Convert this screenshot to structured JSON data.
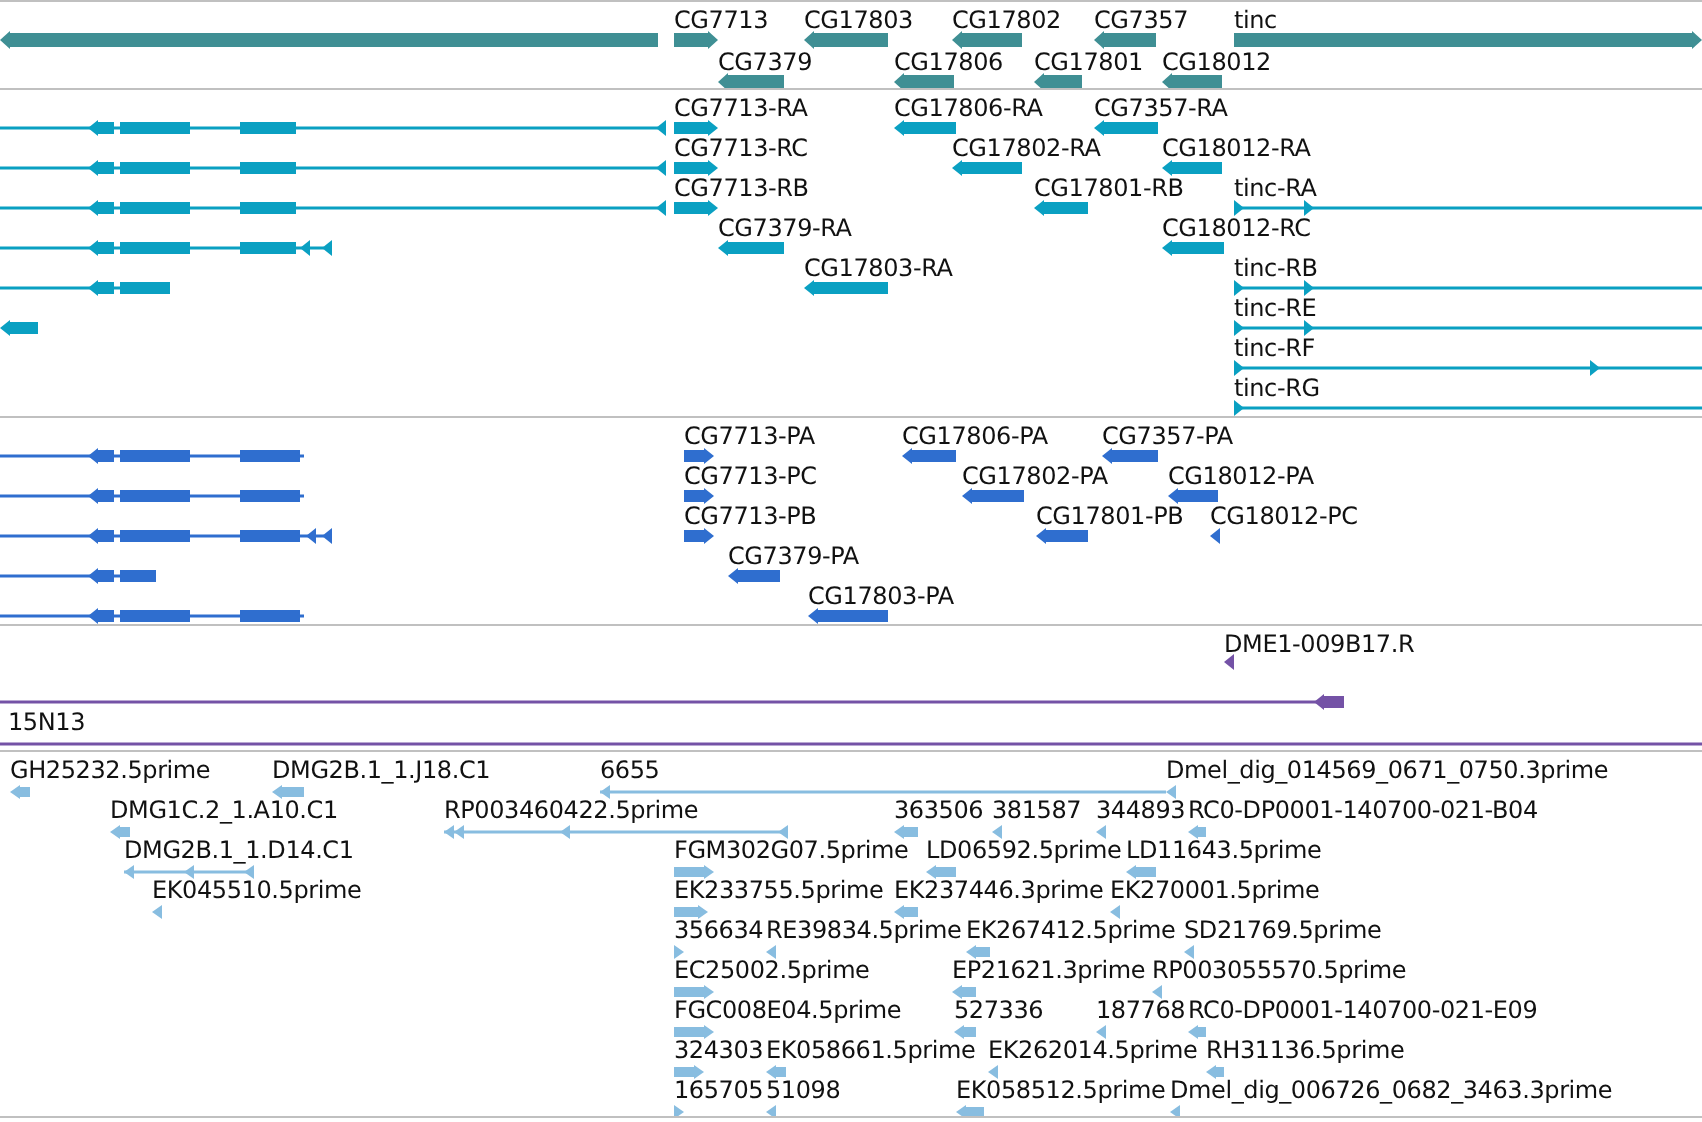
{
  "tracks": [
    {
      "kind": "gene",
      "features": [
        {
          "reverse": true
        },
        {
          "label": "CG7713",
          "reverse": false
        },
        {
          "label": "CG17803",
          "reverse": true
        },
        {
          "label": "CG17802",
          "reverse": true
        },
        {
          "label": "CG7357",
          "reverse": true
        },
        {
          "label": "tinc",
          "reverse": false
        },
        {
          "label": "CG7379",
          "reverse": true
        },
        {
          "label": "CG17806",
          "reverse": true
        },
        {
          "label": "CG17801",
          "reverse": true
        },
        {
          "label": "CG18012",
          "reverse": true
        }
      ]
    },
    {
      "kind": "transcript",
      "features": [
        {
          "reverse": true
        },
        {
          "label": "CG7713-RA",
          "reverse": false
        },
        {
          "label": "CG17806-RA",
          "reverse": true
        },
        {
          "label": "CG7357-RA",
          "reverse": true
        },
        {
          "reverse": true
        },
        {
          "label": "CG7713-RC",
          "reverse": false
        },
        {
          "label": "CG17802-RA",
          "reverse": true
        },
        {
          "label": "CG18012-RA",
          "reverse": true
        },
        {
          "reverse": true
        },
        {
          "label": "CG7713-RB",
          "reverse": false
        },
        {
          "label": "CG17801-RB",
          "reverse": true
        },
        {
          "label": "tinc-RA",
          "reverse": false
        },
        {
          "reverse": true
        },
        {
          "label": "CG7379-RA",
          "reverse": true
        },
        {
          "label": "CG18012-RC",
          "reverse": true
        },
        {
          "reverse": true
        },
        {
          "label": "CG17803-RA",
          "reverse": true
        },
        {
          "label": "tinc-RB",
          "reverse": false
        },
        {
          "reverse": true
        },
        {
          "label": "tinc-RE",
          "reverse": false
        },
        {
          "label": "tinc-RF",
          "reverse": false
        },
        {
          "label": "tinc-RG",
          "reverse": false
        }
      ]
    },
    {
      "kind": "protein",
      "features": [
        {
          "reverse": true
        },
        {
          "label": "CG7713-PA",
          "reverse": false
        },
        {
          "label": "CG17806-PA",
          "reverse": true
        },
        {
          "label": "CG7357-PA",
          "reverse": true
        },
        {
          "reverse": true
        },
        {
          "label": "CG7713-PC",
          "reverse": false
        },
        {
          "label": "CG17802-PA",
          "reverse": true
        },
        {
          "label": "CG18012-PA",
          "reverse": true
        },
        {
          "reverse": true
        },
        {
          "label": "CG7713-PB",
          "reverse": false
        },
        {
          "label": "CG17801-PB",
          "reverse": true
        },
        {
          "label": "CG18012-PC",
          "reverse": true
        },
        {
          "reverse": true
        },
        {
          "label": "CG7379-PA",
          "reverse": true
        },
        {
          "reverse": true
        },
        {
          "label": "CG17803-PA",
          "reverse": true
        }
      ]
    },
    {
      "kind": "clone",
      "features": [
        {
          "label": "DME1-009B17.R",
          "reverse": true
        },
        {
          "label": "15N13",
          "reverse": true
        }
      ]
    },
    {
      "kind": "est",
      "features": [
        {
          "label": "GH25232.5prime",
          "reverse": true
        },
        {
          "label": "DMG2B.1_1.J18.C1",
          "reverse": true
        },
        {
          "label": "6655",
          "reverse": true
        },
        {
          "label": "Dmel_dig_014569_0671_0750.3prime",
          "reverse": true
        },
        {
          "label": "DMG1C.2_1.A10.C1",
          "reverse": true
        },
        {
          "label": "RP003460422.5prime",
          "reverse": true
        },
        {
          "label": "363506",
          "reverse": true
        },
        {
          "label": "381587",
          "reverse": true
        },
        {
          "label": "344893",
          "reverse": true
        },
        {
          "label": "RC0-DP0001-140700-021-B04",
          "reverse": true
        },
        {
          "label": "DMG2B.1_1.D14.C1",
          "reverse": true
        },
        {
          "label": "FGM302G07.5prime",
          "reverse": false
        },
        {
          "label": "LD06592.5prime",
          "reverse": true
        },
        {
          "label": "LD11643.5prime",
          "reverse": true
        },
        {
          "label": "EK045510.5prime",
          "reverse": true
        },
        {
          "label": "EK233755.5prime",
          "reverse": false
        },
        {
          "label": "EK237446.3prime",
          "reverse": true
        },
        {
          "label": "EK270001.5prime",
          "reverse": true
        },
        {
          "label": "356634",
          "reverse": false
        },
        {
          "label": "RE39834.5prime",
          "reverse": true
        },
        {
          "label": "EK267412.5prime",
          "reverse": true
        },
        {
          "label": "SD21769.5prime",
          "reverse": true
        },
        {
          "label": "EC25002.5prime",
          "reverse": false
        },
        {
          "label": "EP21621.3prime",
          "reverse": true
        },
        {
          "label": "RP003055570.5prime",
          "reverse": true
        },
        {
          "label": "FGC008E04.5prime",
          "reverse": false
        },
        {
          "label": "527336",
          "reverse": true
        },
        {
          "label": "187768",
          "reverse": true
        },
        {
          "label": "RC0-DP0001-140700-021-E09",
          "reverse": true
        },
        {
          "label": "324303",
          "reverse": false
        },
        {
          "label": "EK058661.5prime",
          "reverse": true
        },
        {
          "label": "EK262014.5prime",
          "reverse": true
        },
        {
          "label": "RH31136.5prime",
          "reverse": true
        },
        {
          "label": "165705",
          "reverse": false
        },
        {
          "label": "51098",
          "reverse": true
        },
        {
          "label": "EK058512.5prime",
          "reverse": true
        },
        {
          "label": "Dmel_dig_006726_0682_3463.3prime",
          "reverse": true
        }
      ]
    }
  ]
}
